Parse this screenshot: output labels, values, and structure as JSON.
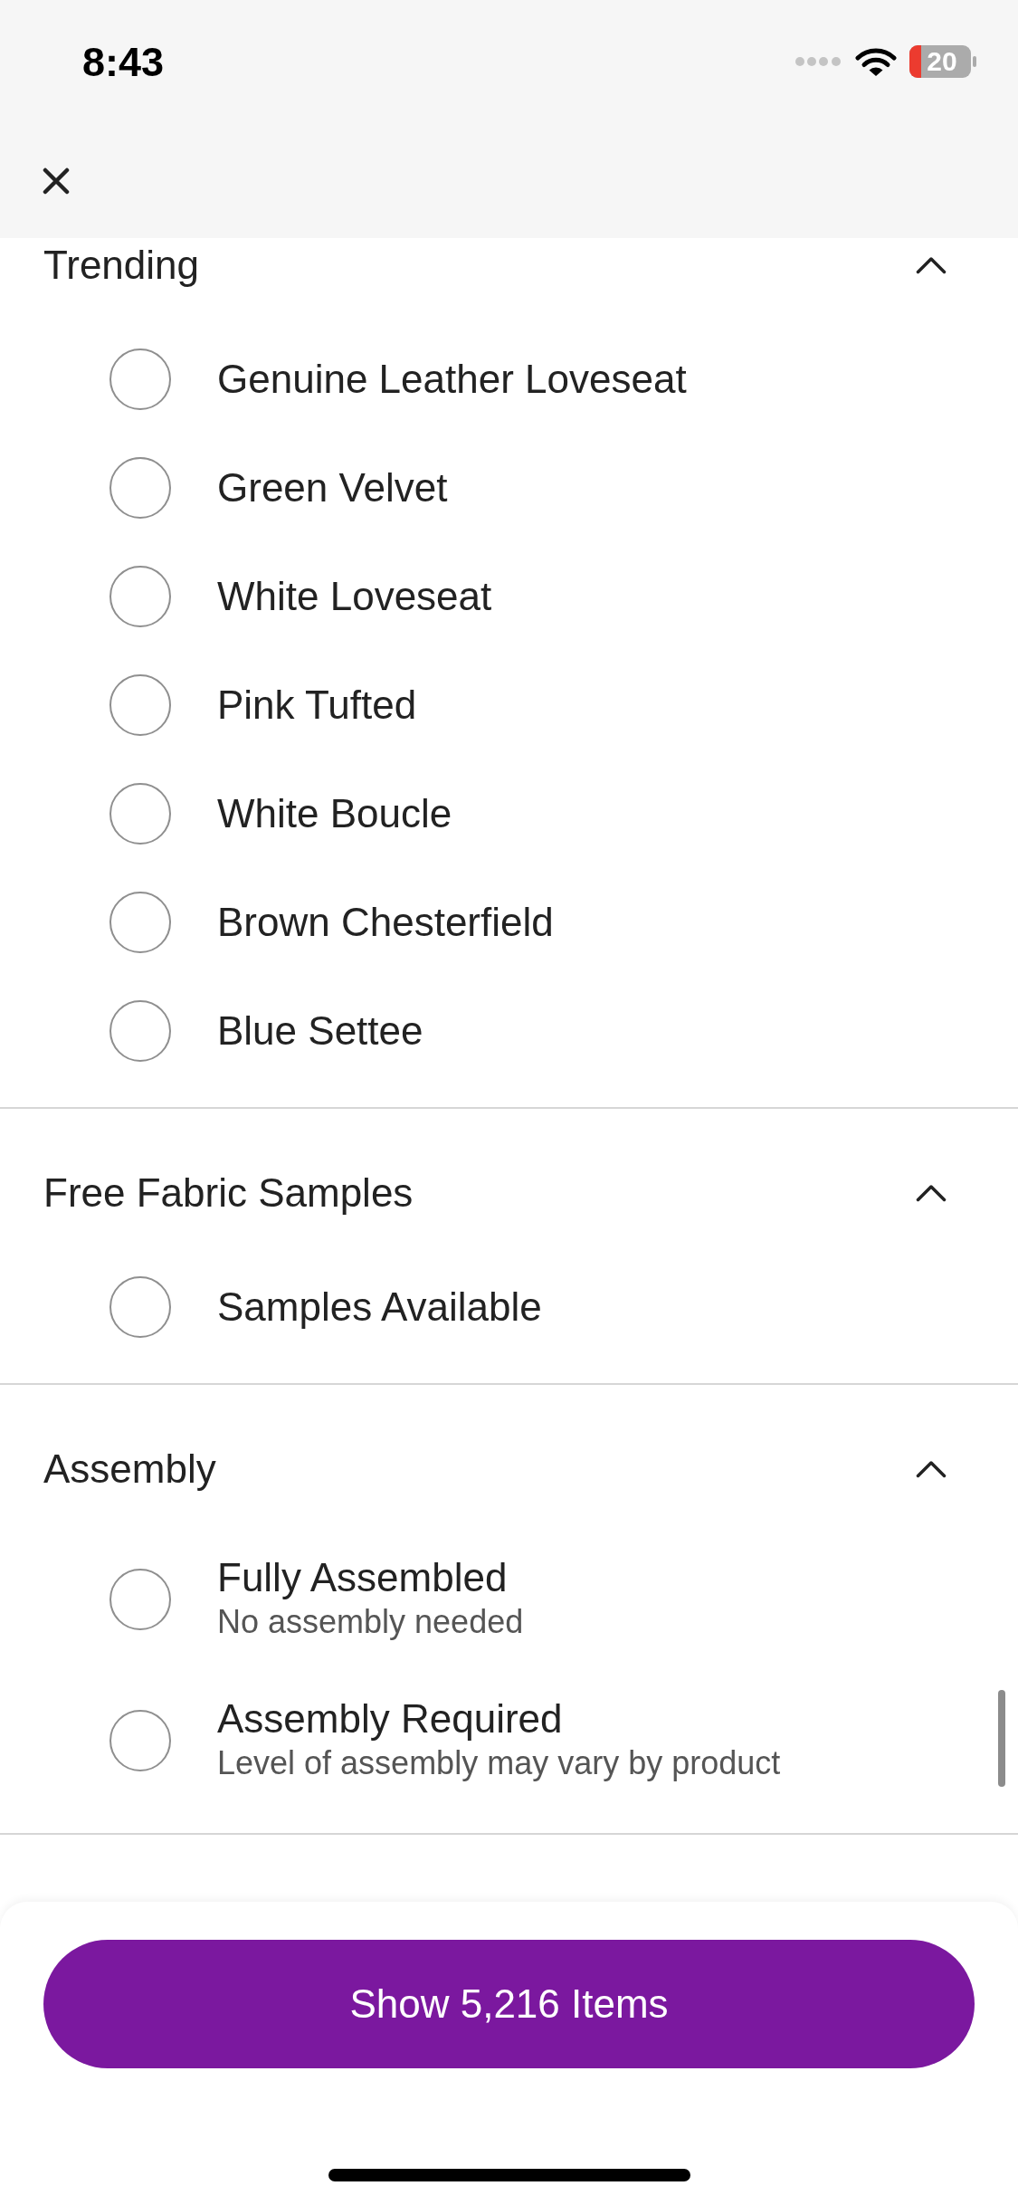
{
  "status_bar": {
    "time": "8:43",
    "battery": "20"
  },
  "filter_groups": [
    {
      "title": "Trending",
      "expanded": true,
      "options": [
        {
          "label": "Genuine Leather Loveseat",
          "selected": false
        },
        {
          "label": "Green Velvet",
          "selected": false
        },
        {
          "label": "White Loveseat",
          "selected": false
        },
        {
          "label": "Pink Tufted",
          "selected": false
        },
        {
          "label": "White Boucle",
          "selected": false
        },
        {
          "label": "Brown Chesterfield",
          "selected": false
        },
        {
          "label": "Blue Settee",
          "selected": false
        }
      ]
    },
    {
      "title": "Free Fabric Samples",
      "expanded": true,
      "options": [
        {
          "label": "Samples Available",
          "selected": false
        }
      ]
    },
    {
      "title": "Assembly",
      "expanded": true,
      "options": [
        {
          "label": "Fully Assembled",
          "description": "No assembly needed",
          "selected": false
        },
        {
          "label": "Assembly Required",
          "description": "Level of assembly may vary by product",
          "selected": false
        }
      ]
    }
  ],
  "footer": {
    "button": "Show 5,216 Items"
  }
}
